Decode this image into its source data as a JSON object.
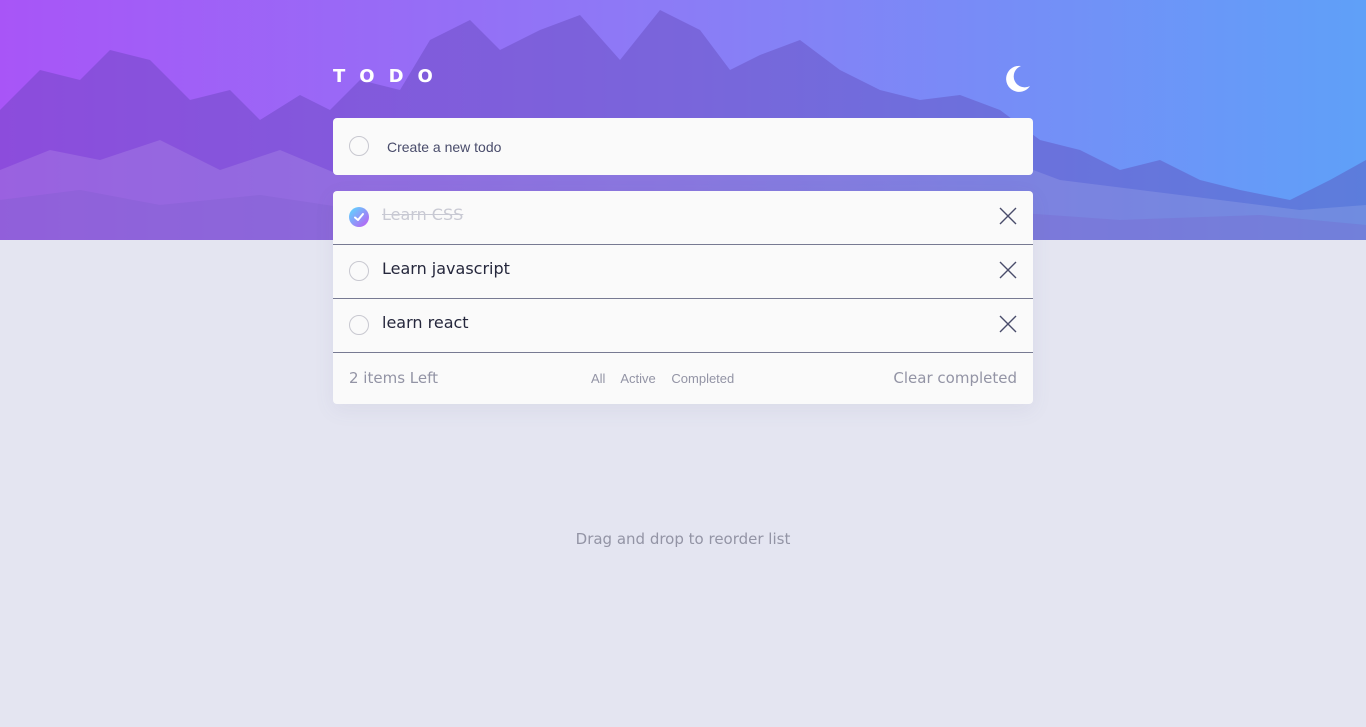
{
  "app": {
    "title": "TODO",
    "theme_icon": "moon-icon"
  },
  "new_todo": {
    "placeholder": "Create a new todo",
    "value": ""
  },
  "todos": [
    {
      "text": "Learn CSS",
      "completed": true
    },
    {
      "text": "Learn javascript",
      "completed": false
    },
    {
      "text": "learn react",
      "completed": false
    }
  ],
  "footer": {
    "items_left": "2 items Left",
    "filters": [
      "All",
      "Active",
      "Completed"
    ],
    "clear_label": "Clear completed"
  },
  "hint": "Drag and drop to reorder list",
  "colors": {
    "accent_gradient_start": "#57ddff",
    "accent_gradient_end": "#c058f3",
    "page_bg": "#e4e5f1",
    "card_bg": "#fafafa"
  }
}
